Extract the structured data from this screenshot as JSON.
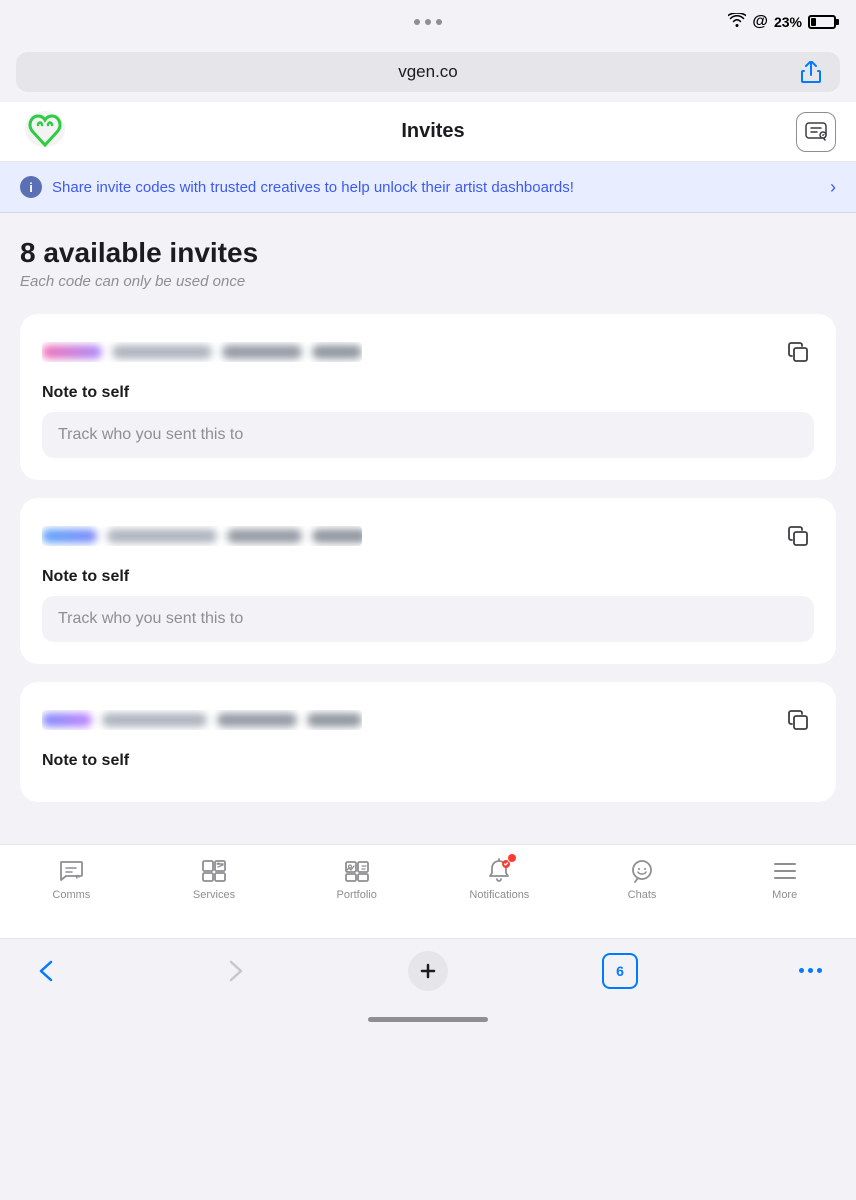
{
  "statusBar": {
    "battery": "23%",
    "dots": 3
  },
  "urlBar": {
    "url": "vgen.co"
  },
  "header": {
    "title": "Invites",
    "logoAlt": "VGen logo"
  },
  "infoBanner": {
    "text": "Share invite codes with trusted creatives to help unlock their artist dashboards!"
  },
  "invites": {
    "count": "8 available invites",
    "subtitle": "Each code can only be used once",
    "notePlaceholder": "Track who you sent this to",
    "noteLabel": "Note to self",
    "cards": [
      {
        "id": 1,
        "borderStyle": "pink-purple"
      },
      {
        "id": 2,
        "borderStyle": "blue-green"
      },
      {
        "id": 3,
        "borderStyle": "purple-pink"
      }
    ]
  },
  "bottomNav": {
    "items": [
      {
        "label": "Comms",
        "icon": "comms-icon",
        "active": false
      },
      {
        "label": "Services",
        "icon": "services-icon",
        "active": false
      },
      {
        "label": "Portfolio",
        "icon": "portfolio-icon",
        "active": false
      },
      {
        "label": "Notifications",
        "icon": "notifications-icon",
        "active": false,
        "badge": true
      },
      {
        "label": "Chats",
        "icon": "chats-icon",
        "active": false
      },
      {
        "label": "More",
        "icon": "more-icon",
        "active": false
      }
    ]
  },
  "browserBar": {
    "tabsCount": "6",
    "backDisabled": false,
    "forwardDisabled": true
  }
}
